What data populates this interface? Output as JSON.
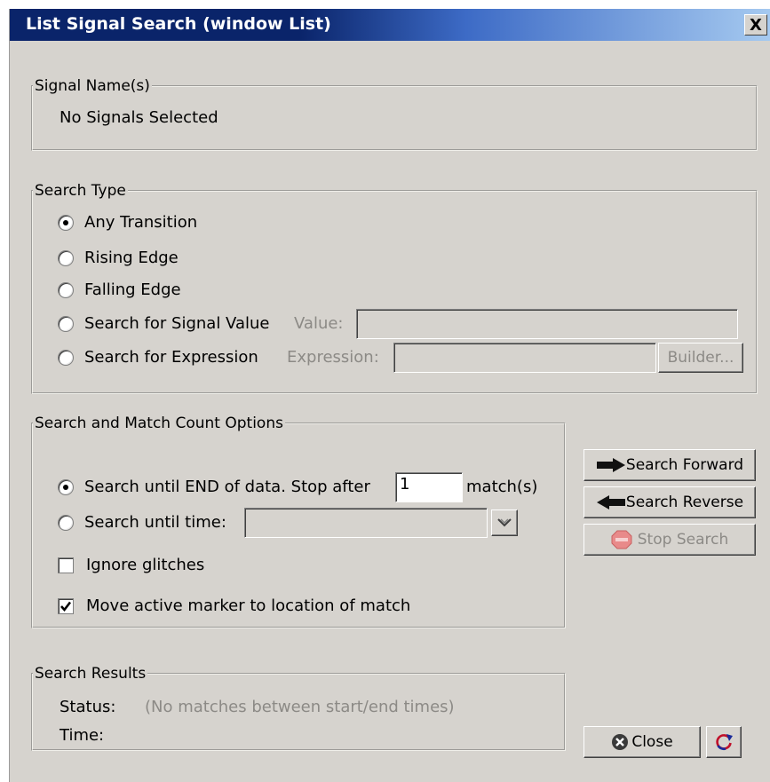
{
  "window": {
    "title": "List Signal Search (window List)",
    "close_glyph": "X"
  },
  "signal_names": {
    "legend": "Signal Name(s)",
    "value": "No Signals Selected"
  },
  "search_type": {
    "legend": "Search Type",
    "options": [
      {
        "label": "Any Transition",
        "selected": true
      },
      {
        "label": "Rising Edge",
        "selected": false
      },
      {
        "label": "Falling Edge",
        "selected": false
      },
      {
        "label": "Search for Signal Value",
        "selected": false
      },
      {
        "label": "Search for Expression",
        "selected": false
      }
    ],
    "value_label": "Value:",
    "value_input": "",
    "expression_label": "Expression:",
    "expression_input": "",
    "builder_button": "Builder..."
  },
  "match_options": {
    "legend": "Search and Match Count Options",
    "until_end_label": "Search until END of data.  Stop after",
    "stop_after_value": "1",
    "matches_suffix": "match(s)",
    "until_time_label": "Search until time:",
    "until_time_value": "",
    "ignore_glitches_label": "Ignore glitches",
    "ignore_glitches_checked": false,
    "move_marker_label": "Move active marker to location of match",
    "move_marker_checked": true
  },
  "actions": {
    "search_forward": "Search Forward",
    "search_reverse": "Search Reverse",
    "stop_search": "Stop Search",
    "close": "Close"
  },
  "results": {
    "legend": "Search Results",
    "status_label": "Status:",
    "status_value": "(No matches between start/end times)",
    "time_label": "Time:",
    "time_value": ""
  },
  "colors": {
    "title_bar_dark": "#0a246a",
    "title_bar_light": "#a6caf0",
    "dialog_bg": "#d6d3ce",
    "disabled_text": "#8c8a86",
    "refresh_icon": "#c0102a"
  },
  "icons": [
    "arrow-right-icon",
    "arrow-left-icon",
    "stop-search-icon",
    "close-circle-icon",
    "refresh-icon",
    "dropdown-arrow-icon"
  ]
}
